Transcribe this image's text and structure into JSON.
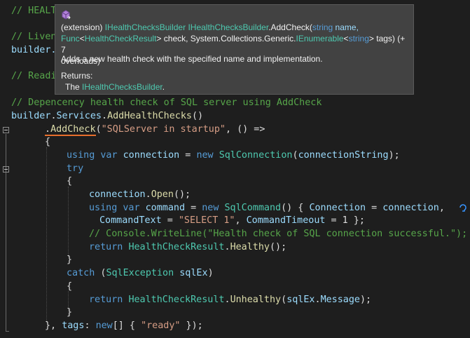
{
  "editor": {
    "lines": {
      "l1": "// HEALT",
      "l2": "// Liven",
      "l3": "builder.",
      "l4": "// Readi",
      "l5": "// Depencency health check of SQL server using AddCheck",
      "l6a": "builder",
      "l6b": ".",
      "l6c": "Services",
      "l6d": ".",
      "l6e": "AddHealthChecks",
      "l6f": "()",
      "l7a": ".",
      "l7b": "AddCheck",
      "l7c": "(",
      "l7d": "\"SQLServer in startup\"",
      "l7e": ", () =>",
      "l8": "{",
      "l9a": "using",
      "l9b": " ",
      "l9c": "var",
      "l9d": " ",
      "l9e": "connection",
      "l9f": " = ",
      "l9g": "new",
      "l9h": " ",
      "l9i": "SqlConnection",
      "l9j": "(",
      "l9k": "connectionString",
      "l9l": ");",
      "l10": "try",
      "l11": "{",
      "l12a": "connection",
      "l12b": ".",
      "l12c": "Open",
      "l12d": "();",
      "l13a": "using",
      "l13b": " ",
      "l13c": "var",
      "l13d": " ",
      "l13e": "command",
      "l13f": " = ",
      "l13g": "new",
      "l13h": " ",
      "l13i": "SqlCommand",
      "l13j": "() { ",
      "l13k": "Connection",
      "l13l": " = ",
      "l13m": "connection",
      "l13n": ",",
      "l14a": "CommandText",
      "l14b": " = ",
      "l14c": "\"SELECT 1\"",
      "l14d": ", ",
      "l14e": "CommandTimeout",
      "l14f": " = 1 };",
      "l15": "// Console.WriteLine(\"Health check of SQL connection successful.\");",
      "l16a": "return",
      "l16b": " ",
      "l16c": "HealthCheckResult",
      "l16d": ".",
      "l16e": "Healthy",
      "l16f": "();",
      "l17": "}",
      "l18a": "catch",
      "l18b": " (",
      "l18c": "SqlException",
      "l18d": " ",
      "l18e": "sqlEx",
      "l18f": ")",
      "l19": "{",
      "l20a": "return",
      "l20b": " ",
      "l20c": "HealthCheckResult",
      "l20d": ".",
      "l20e": "Unhealthy",
      "l20f": "(",
      "l20g": "sqlEx",
      "l20h": ".",
      "l20i": "Message",
      "l20j": ");",
      "l21": "}",
      "l22a": "}, ",
      "l22b": "tags",
      "l22c": ": ",
      "l22d": "new",
      "l22e": "[] { ",
      "l22f": "\"ready\"",
      "l22g": " });"
    }
  },
  "tooltip": {
    "sig1": "(extension) ",
    "sig2": "IHealthChecksBuilder",
    "sig3": " ",
    "sig4": "IHealthChecksBuilder",
    "sig5": ".AddCheck(",
    "sig6": "string",
    "sig7": " name,",
    "sig8": "Func",
    "sig9": "<",
    "sig10": "HealthCheckResult",
    "sig11": "> check, System.Collections.Generic.",
    "sig12": "IEnumerable",
    "sig13": "<",
    "sig14": "string",
    "sig15": "> tags) (+ 7",
    "sig16": "overloads)",
    "description": "Adds a new health check with the specified name and implementation.",
    "returns_label": "Returns:",
    "returns_prefix": "The ",
    "returns_type": "IHealthChecksBuilder",
    "returns_suffix": "."
  },
  "icons": {
    "tooltip": "extension-method-icon",
    "hint": "quick-action-icon"
  },
  "colors": {
    "comment": "#57a64a",
    "keyword": "#569cd6",
    "type": "#4ec9b0",
    "string": "#d69d85",
    "method": "#dcdcaa",
    "variable": "#9cdcfe",
    "squiggle": "#e76f2c"
  }
}
